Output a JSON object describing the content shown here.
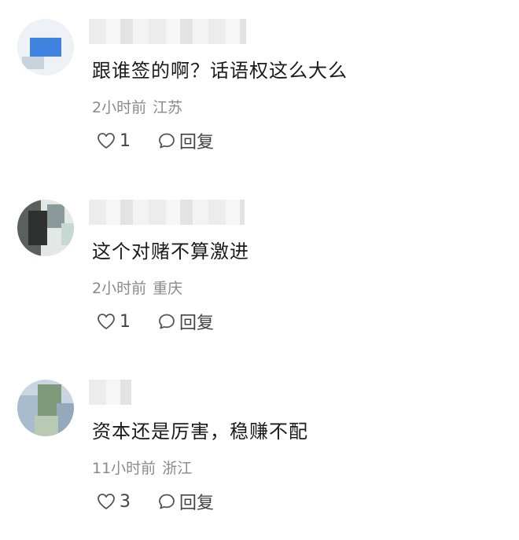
{
  "comments": [
    {
      "text": "跟谁签的啊？话语权这么大么",
      "time": "2小时前",
      "location": "江苏",
      "likes": "1",
      "reply_label": "回复",
      "avatar_colors": [
        "#3f83e0",
        "#dde6ef",
        "#a9b6c4"
      ]
    },
    {
      "text": "这个对赌不算激进",
      "time": "2小时前",
      "location": "重庆",
      "likes": "1",
      "reply_label": "回复",
      "avatar_colors": [
        "#3b3b3b",
        "#7a8a8f",
        "#c3d3cf"
      ]
    },
    {
      "text": "资本还是厉害，稳赚不配",
      "time": "11小时前",
      "location": "浙江",
      "likes": "3",
      "reply_label": "回复",
      "avatar_colors": [
        "#7f9a7a",
        "#b6c8d8",
        "#94a9bb"
      ]
    }
  ]
}
